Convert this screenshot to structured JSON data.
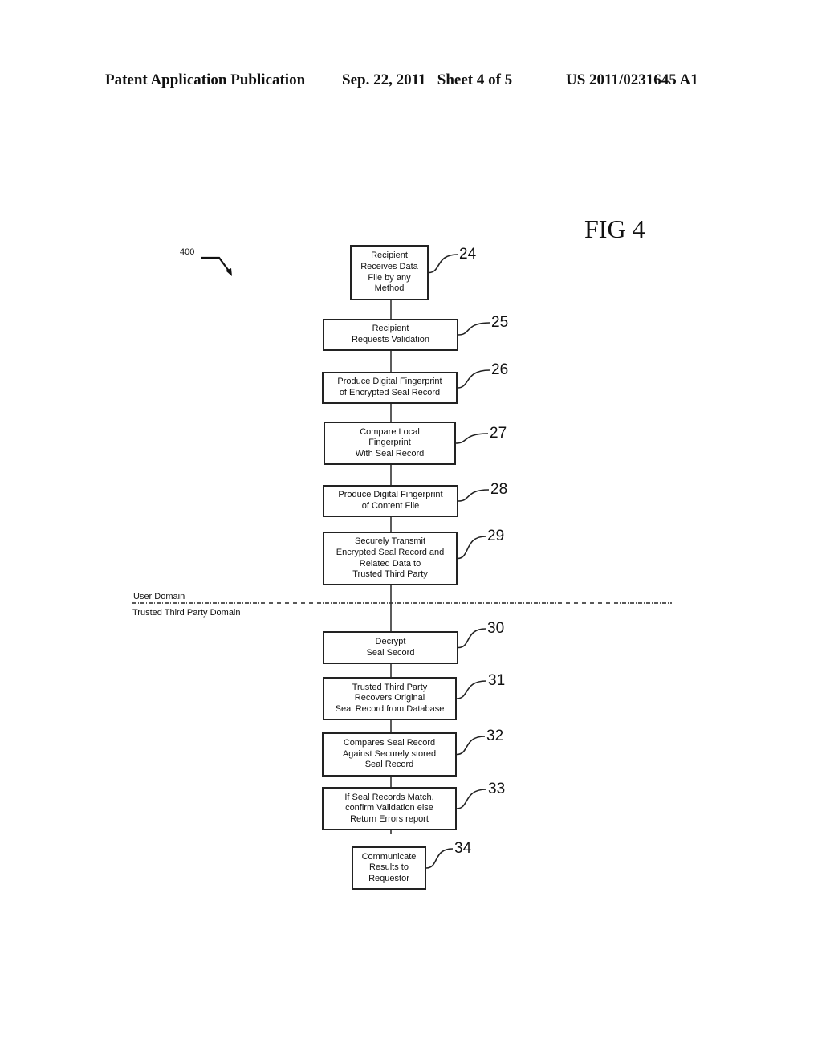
{
  "header": {
    "publication": "Patent Application Publication",
    "date_sheet": "Sep. 22, 2011   Sheet 4 of 5",
    "patent_number": "US 2011/0231645 A1"
  },
  "figure": {
    "title": "FIG 4",
    "reference": "400"
  },
  "domains": {
    "upper": "User Domain",
    "lower": "Trusted Third Party Domain"
  },
  "steps": [
    {
      "id": "24",
      "lines": [
        "Recipient",
        "Receives Data",
        "File by any",
        "Method"
      ]
    },
    {
      "id": "25",
      "lines": [
        "Recipient",
        "Requests Validation"
      ]
    },
    {
      "id": "26",
      "lines": [
        "Produce Digital Fingerprint",
        "of Encrypted Seal Record"
      ]
    },
    {
      "id": "27",
      "lines": [
        "Compare Local",
        "Fingerprint",
        "With Seal Record"
      ]
    },
    {
      "id": "28",
      "lines": [
        "Produce Digital Fingerprint",
        "of Content File"
      ]
    },
    {
      "id": "29",
      "lines": [
        "Securely Transmit",
        "Encrypted Seal Record and",
        "Related Data to",
        "Trusted Third Party"
      ]
    },
    {
      "id": "30",
      "lines": [
        "Decrypt",
        "Seal Secord"
      ]
    },
    {
      "id": "31",
      "lines": [
        "Trusted Third Party",
        "Recovers Original",
        "Seal Record from Database"
      ]
    },
    {
      "id": "32",
      "lines": [
        "Compares Seal Record",
        "Against Securely stored",
        "Seal Record"
      ]
    },
    {
      "id": "33",
      "lines": [
        "If Seal Records Match,",
        "confirm Validation else",
        "Return Errors report"
      ]
    },
    {
      "id": "34",
      "lines": [
        "Communicate",
        "Results to",
        "Requestor"
      ]
    }
  ]
}
